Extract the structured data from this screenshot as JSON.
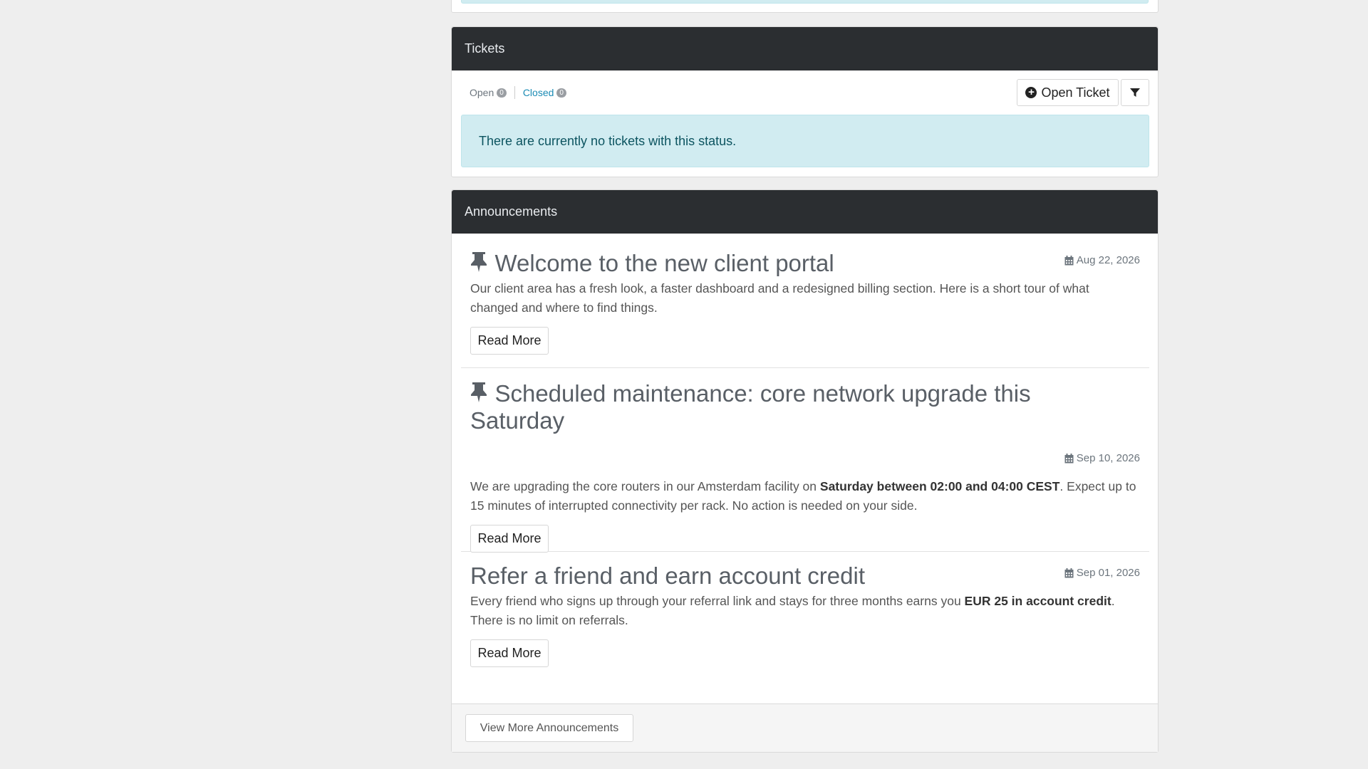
{
  "tickets": {
    "title": "Tickets",
    "tabs": [
      {
        "label": "Open",
        "count": "0"
      },
      {
        "label": "Closed",
        "count": "0"
      }
    ],
    "open_ticket_label": "Open Ticket",
    "empty_message": "There are currently no tickets with this status."
  },
  "announcements": {
    "title": "Announcements",
    "items": [
      {
        "title": "Welcome to the new client portal",
        "pinned": true,
        "date": "Aug 22, 2026",
        "text": "Our client area has a fresh look, a faster dashboard and a redesigned billing section. Here is a short tour of what changed and where to find things.",
        "read_more": "Read More"
      },
      {
        "title_line1": "Scheduled maintenance: core network upgrade this",
        "title_line2": "Saturday",
        "pinned": true,
        "date": "Sep 10, 2026",
        "text_before": "We are upgrading the core routers in our Amsterdam facility on ",
        "text_bold": "Saturday between 02:00 and 04:00 CEST",
        "text_after": ". Expect up to 15 minutes of interrupted connectivity per rack. No action is needed on your side.",
        "read_more": "Read More"
      },
      {
        "title": "Refer a friend and earn account credit",
        "pinned": false,
        "date": "Sep 01, 2026",
        "text_before": "Every friend who signs up through your referral link and stays for three months earns you ",
        "text_bold": "EUR 25 in account credit",
        "text_after": ". There is no limit on referrals.",
        "read_more": "Read More"
      }
    ],
    "view_more_label": "View More Announcements"
  },
  "icons": {
    "pin": "thumbtack-icon",
    "calendar": "calendar-icon",
    "plus": "plus-circle-icon",
    "filter": "filter-icon"
  },
  "colors": {
    "header_bg": "#2b2e31",
    "info_bg": "#d1ecf1",
    "info_text": "#0c5460",
    "link": "#1b8bb4"
  }
}
